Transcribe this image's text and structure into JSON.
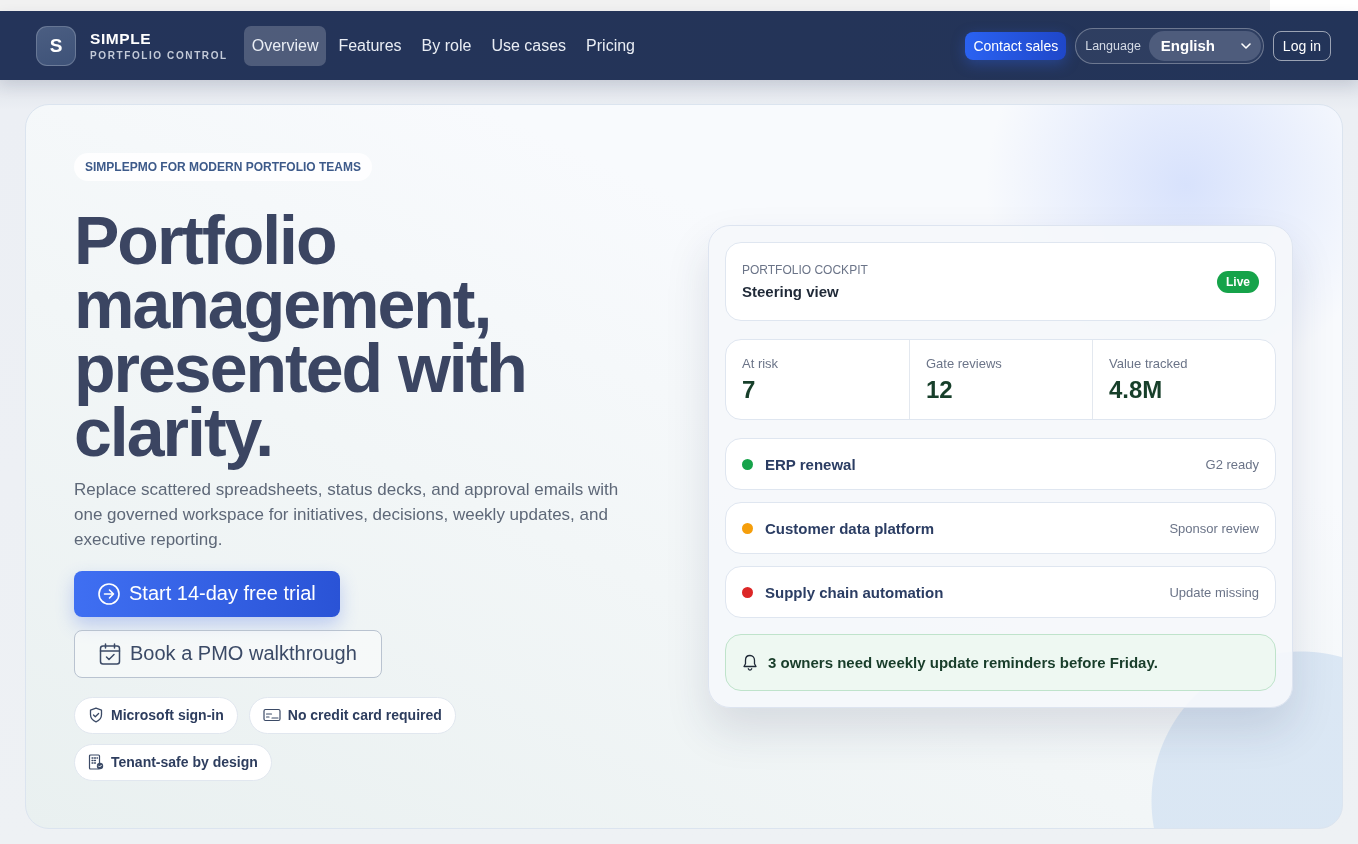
{
  "nav": {
    "logo": {
      "mark": "S",
      "name": "SIMPLE",
      "tagline": "PORTFOLIO CONTROL"
    },
    "links": [
      {
        "label": "Overview",
        "selected": true
      },
      {
        "label": "Features",
        "selected": false
      },
      {
        "label": "By role",
        "selected": false
      },
      {
        "label": "Use cases",
        "selected": false
      },
      {
        "label": "Pricing",
        "selected": false
      }
    ],
    "contact_button": "Contact sales",
    "language": {
      "label": "Language",
      "value": "English"
    },
    "login_button": "Log in"
  },
  "hero": {
    "eyebrow": "SIMPLEPMO FOR MODERN PORTFOLIO TEAMS",
    "heading": "Portfolio management, presented with clarity.",
    "description": "Replace scattered spreadsheets, status decks, and approval emails with one governed workspace for initiatives, decisions, weekly updates, and executive reporting.",
    "primary_button": "Start 14-day free trial",
    "secondary_button": "Book a PMO walkthrough",
    "badges": [
      {
        "kind": "shield",
        "label": "Microsoft sign-in"
      },
      {
        "kind": "card",
        "label": "No credit card required"
      },
      {
        "kind": "building",
        "label": "Tenant-safe by design"
      }
    ]
  },
  "cockpit": {
    "eyebrow": "PORTFOLIO COCKPIT",
    "title": "Steering view",
    "status": "Live",
    "stats": [
      {
        "label": "At risk",
        "value": "7"
      },
      {
        "label": "Gate reviews",
        "value": "12"
      },
      {
        "label": "Value tracked",
        "value": "4.8M"
      }
    ],
    "initiatives": [
      {
        "name": "ERP renewal",
        "status": "G2 ready",
        "color": "#16a34a"
      },
      {
        "name": "Customer data platform",
        "status": "Sponsor review",
        "color": "#f59e0b"
      },
      {
        "name": "Supply chain automation",
        "status": "Update missing",
        "color": "#dc2626"
      }
    ],
    "alert": "3 owners need weekly update reminders before Friday."
  }
}
